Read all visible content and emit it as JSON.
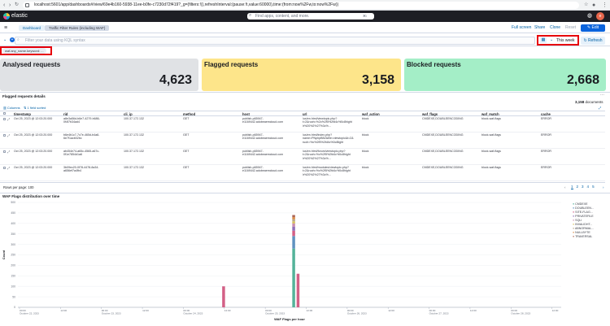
{
  "browser": {
    "url": "localhost:5601/app/dashboards#/view/69e4b160-5938-11ee-b0fe-c7230d72f419?_g=(filters:!(),refreshInterval:(pause:!t,value:60000),time:(from:now%2Fw,to:now%2Fw))"
  },
  "kibana": {
    "logo": "elastic",
    "search_placeholder": "Find apps, content, and more.",
    "search_shortcut": "⌘/"
  },
  "breadcrumbs": [
    "Dashboard",
    "Traffic Filter Rules (including WAF)"
  ],
  "toolbar": {
    "full_screen": "Full screen",
    "share": "Share",
    "clone": "Clone",
    "reset": "Reset",
    "edit": "Edit"
  },
  "query": {
    "placeholder": "Filter your data using KQL syntax",
    "time_range": "This week",
    "refresh": "Refresh"
  },
  "filter": {
    "pill": "waf.any_name.keyword: ..."
  },
  "metrics": [
    {
      "title": "Analysed requests",
      "value": "4,623",
      "color": "#e0e2e5"
    },
    {
      "title": "Flagged requests",
      "value": "3,158",
      "color": "#fde58a"
    },
    {
      "title": "Blocked requests",
      "value": "2,668",
      "color": "#a4eec7"
    }
  ],
  "table": {
    "title": "Flagged requests details",
    "doc_count": "3,158",
    "doc_label": "documents",
    "columns_btn": "Columns",
    "sort_btn": "1 field sorted",
    "headers": [
      "timestamp",
      "rid",
      "cli_ip",
      "method",
      "host",
      "url",
      "waf_action",
      "waf_flags",
      "waf_match",
      "cache"
    ],
    "rows": [
      [
        "Oct 25, 2023 @ 12:03:20.000",
        "a8e3a56d-b6e7-4279-b686-\n0f4f7b34ad4",
        "100.37.172.132",
        "GET",
        "publish-p65947-\ne1169442.adobeaemcloud.com",
        "/us/en.html/viewtopic.php?\nt=2&ruoh=%2c%2f5%2fd4c%0c8hight\nlr%20%2%27%3c%...",
        "block",
        "CMDEXE,DOUBLEENCODING",
        "block-waf-flags",
        "ERROR"
      ],
      [
        "Oct 25, 2023 @ 12:03:20.000",
        "b6e4b1c7-7c7e-465d-b4a8-\n6e7f1acb02bc",
        "100.37.172.132",
        "GET",
        "publish-p65947-\ne1169442.adobeaemcloud.com",
        "/us/en.html/index.php?\nname=PNphpBB2&file=viewtopic&t=2&\nruoh=%c%2f5%2fd4c%0c8light",
        "block",
        "CMDEXE,DOUBLEENCODING",
        "block-waf-flags",
        "ERROR"
      ],
      [
        "Oct 25, 2023 @ 12:03:20.000",
        "ab454e74-a65c-4565-a67c-\n0f1e7854d1a6",
        "100.37.172.132",
        "GET",
        "publish-p65947-\ne1169442.adobeaemcloud.com",
        "/us/en.html/forum/viewtopic.php?\nt=2&ruoh=%c%2f5%2fd4c%0c8hight\nlr%20%2%27%3c%...",
        "block",
        "CMDEXE,DOUBLEENCODING",
        "block-waf-flags",
        "ERROR"
      ],
      [
        "Oct 25, 2023 @ 12:03:20.000",
        "3b09ec20-0f78-4478-8a34-\na656ef7a4fb4",
        "100.37.172.132",
        "GET",
        "publish-p65947-\ne1169442.adobeaemcloud.com",
        "/us/en.html/modules/viewtopic.php?\nt=2&ruoh=%c%2f5%2fd4c%0c8hight\nlr%20%2%27%3c%...",
        "block",
        "CMDEXE,DOUBLEENCODING",
        "block-waf-flags",
        "ERROR"
      ]
    ],
    "rows_per_page": "Rows per page: 100",
    "pages": [
      "1",
      "2",
      "3",
      "4",
      "5"
    ]
  },
  "chart_title": "WAF Flags distribution over time",
  "chart_data": {
    "type": "bar",
    "stacked": true,
    "title": "WAF Flags distribution over time",
    "xlabel": "WAF Flags per hour",
    "ylabel": "Count",
    "ylim": [
      0,
      500
    ],
    "yticks": [
      0,
      50,
      100,
      150,
      200,
      250,
      300,
      350,
      400,
      450,
      500
    ],
    "xticks": [
      "00:00\nOctober 22, 2023",
      "12:00",
      "00:00\nOctober 23, 2023",
      "12:00",
      "00:00\nOctober 24, 2023",
      "12:00",
      "00:00\nOctober 25, 2023",
      "12:00",
      "00:00\nOctober 26, 2023",
      "12:00",
      "00:00\nOctober 27, 2023",
      "12:00",
      "00:00\nOctober 28, 2023",
      "12:00"
    ],
    "legend_position": "right",
    "legend": [
      {
        "name": "CMDEXE",
        "color": "#54b399"
      },
      {
        "name": "DOUBLEEN...",
        "color": "#6092c0"
      },
      {
        "name": "SITE-FLAG...",
        "color": "#d36086"
      },
      {
        "name": "PRIVATEFILE",
        "color": "#9170b8"
      },
      {
        "name": "SQLI",
        "color": "#ca8eae"
      },
      {
        "name": "INVALIDHT...",
        "color": "#d6bf57"
      },
      {
        "name": "ABNORMAL...",
        "color": "#b9a888"
      },
      {
        "name": "NULLBYTE",
        "color": "#da8b45"
      },
      {
        "name": "TRAVERSAL",
        "color": "#aa6556"
      }
    ],
    "bars": [
      {
        "pos": 0.376,
        "segments": [
          {
            "series": "SITE-FLAG...",
            "value": 100
          }
        ]
      },
      {
        "pos": 0.505,
        "segments": [
          {
            "series": "CMDEXE",
            "value": 280
          },
          {
            "series": "DOUBLEEN...",
            "value": 60
          },
          {
            "series": "SITE-FLAG...",
            "value": 25
          },
          {
            "series": "PRIVATEFILE",
            "value": 20
          },
          {
            "series": "SQLI",
            "value": 15
          },
          {
            "series": "INVALIDHT...",
            "value": 10
          },
          {
            "series": "ABNORMAL...",
            "value": 10
          },
          {
            "series": "NULLBYTE",
            "value": 10
          },
          {
            "series": "TRAVERSAL",
            "value": 10
          }
        ]
      },
      {
        "pos": 0.513,
        "segments": [
          {
            "series": "SITE-FLAG...",
            "value": 160
          }
        ]
      }
    ]
  }
}
